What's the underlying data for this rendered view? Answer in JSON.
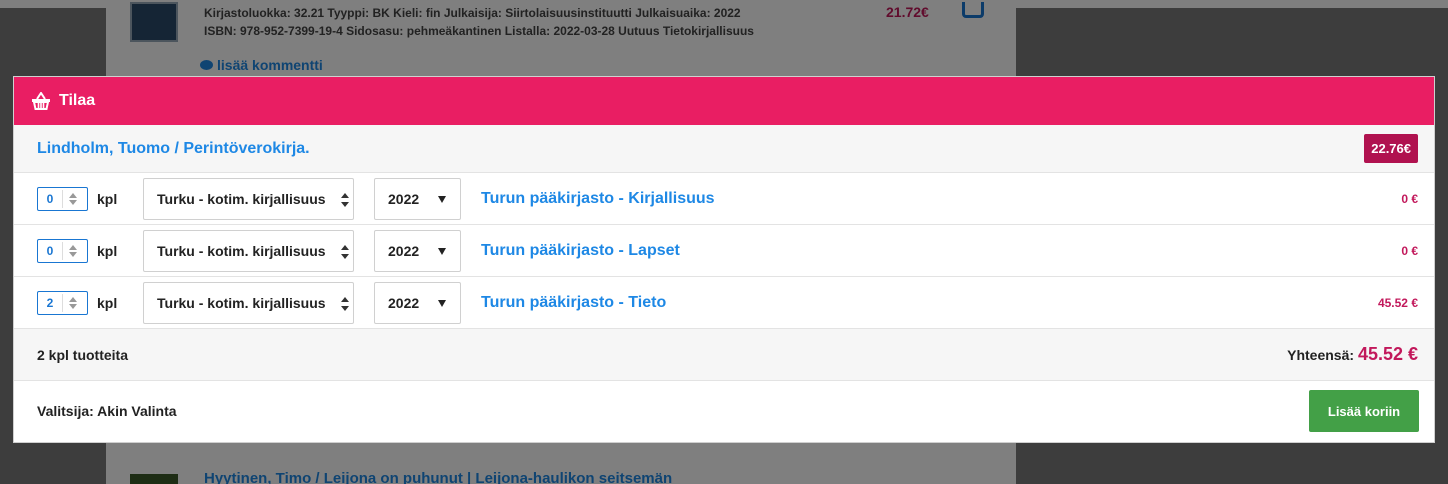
{
  "background": {
    "meta_line1": "Kirjastoluokka: 32.21  Tyyppi: BK  Kieli: fin  Julkaisija: Siirtolaisuusinstituutti  Julkaisuaika: 2022",
    "meta_line2": "ISBN: 978-952-7399-19-4  Sidosasu: pehmeäkantinen  Listalla: 2022-03-28 Uutuus Tietokirjallisuus",
    "price": "21.72€",
    "comment_link": "lisää kommentti",
    "next_title": "Hyytinen, Timo / Leijona on puhunut | Leijona-haulikon seitsemän"
  },
  "modal": {
    "title": "Tilaa",
    "product_title": "Lindholm, Tuomo / Perintöverokirja.",
    "unit_price": "22.76€",
    "rows": [
      {
        "qty": "0",
        "unit": "kpl",
        "library": "Turku - kotim. kirjallisuus",
        "year": "2022",
        "branch": "Turun pääkirjasto - Kirjallisuus",
        "price": "0 €"
      },
      {
        "qty": "0",
        "unit": "kpl",
        "library": "Turku - kotim. kirjallisuus",
        "year": "2022",
        "branch": "Turun pääkirjasto - Lapset",
        "price": "0 €"
      },
      {
        "qty": "2",
        "unit": "kpl",
        "library": "Turku - kotim. kirjallisuus",
        "year": "2022",
        "branch": "Turun pääkirjasto - Tieto",
        "price": "45.52 €"
      }
    ],
    "summary_count": "2 kpl tuotteita",
    "total_label": "Yhteensä:",
    "total_value": "45.52 €",
    "selector": "Valitsija: Akin Valinta",
    "add_button": "Lisää koriin"
  },
  "colors": {
    "header": "#e91e63",
    "link": "#1e88e5",
    "price": "#c2185b",
    "button": "#43a047"
  },
  "icons": [
    "basket-icon",
    "comment-icon",
    "cart-icon"
  ]
}
